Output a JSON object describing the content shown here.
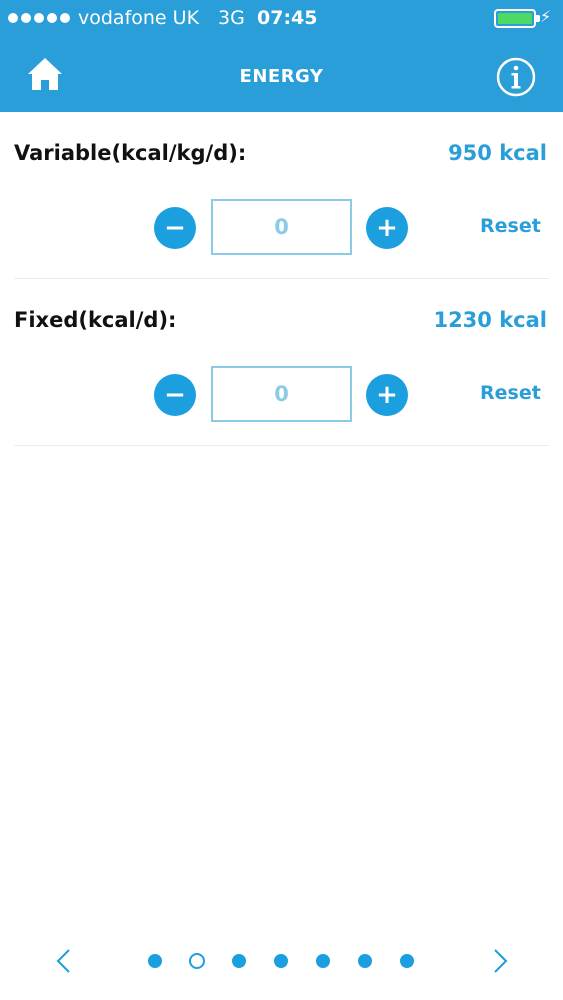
{
  "status_bar": {
    "carrier": "vodafone UK",
    "network": "3G",
    "time": "07:45",
    "battery_color": "#4cd964",
    "charging_glyph": "⚡"
  },
  "nav": {
    "title": "ENERGY",
    "left_icon": "home-icon",
    "right_icon": "info-icon"
  },
  "sections": [
    {
      "label": "Variable(kcal/kg/d):",
      "value": "950 kcal",
      "input_value": "0",
      "minus_label": "−",
      "plus_label": "+",
      "reset_label": "Reset"
    },
    {
      "label": "Fixed(kcal/d):",
      "value": "1230 kcal",
      "input_value": "0",
      "minus_label": "−",
      "plus_label": "+",
      "reset_label": "Reset"
    }
  ],
  "pager": {
    "total_pages": 7,
    "current_page": 2
  },
  "colors": {
    "accent": "#2a9ed8",
    "button": "#1b9fdf",
    "input_border": "#8ccbe8"
  }
}
